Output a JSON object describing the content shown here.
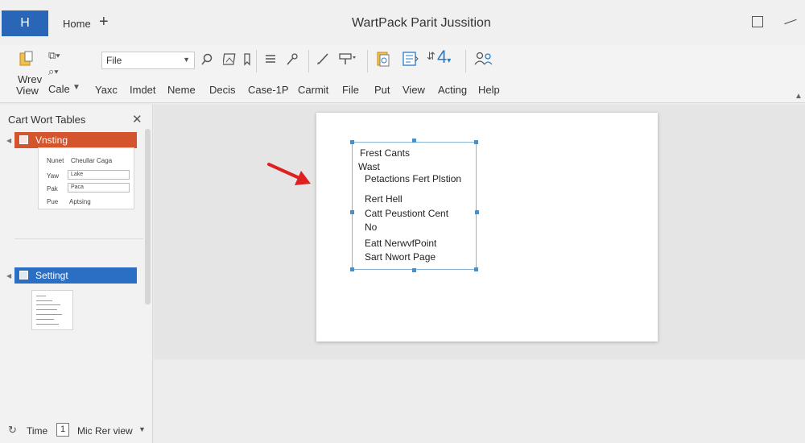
{
  "titlebar": {
    "app_icon": "H",
    "home_tab": "Home",
    "add_tab": "+",
    "document_title": "WartPack Parit Jussition"
  },
  "ribbon": {
    "view_group": {
      "line1": "Wrev",
      "line2": "View"
    },
    "cale_label": "Cale",
    "font_box_value": "File",
    "tabs": [
      "Yaxc",
      "Imdet",
      "Neme",
      "Decis",
      "Case-1P",
      "Carmit",
      "File",
      "Put",
      "View",
      "Acting",
      "Help"
    ]
  },
  "pane": {
    "title": "Cart Wort Tables",
    "section1": {
      "label": "Vnsting",
      "color": "#d3542d",
      "card": {
        "header_left": "Nunet",
        "header_right": "Cheullar Caga",
        "rows": [
          {
            "label": "Yaw",
            "value": "Lake"
          },
          {
            "label": "Pak",
            "value": "Paca"
          },
          {
            "label": "Pue",
            "value": "Aptsing"
          }
        ]
      }
    },
    "section2": {
      "label": "Settingt",
      "color": "#2a6fc4"
    }
  },
  "status": {
    "time_label": "Time",
    "page_number": "1",
    "view_label": "Mic Rer view"
  },
  "slide": {
    "lines": [
      "Frest Cants",
      "Wast",
      "Petactions Fert Plstion",
      "Rert  Hell",
      "Catt  Peustiont Cent",
      "No",
      "Eatt  NerwvfPoint",
      "Sart  Nwort Page"
    ],
    "arrow_color": "#e02020"
  },
  "colors": {
    "accent": "#2a66b8",
    "selection_handle": "#4a90c8"
  }
}
